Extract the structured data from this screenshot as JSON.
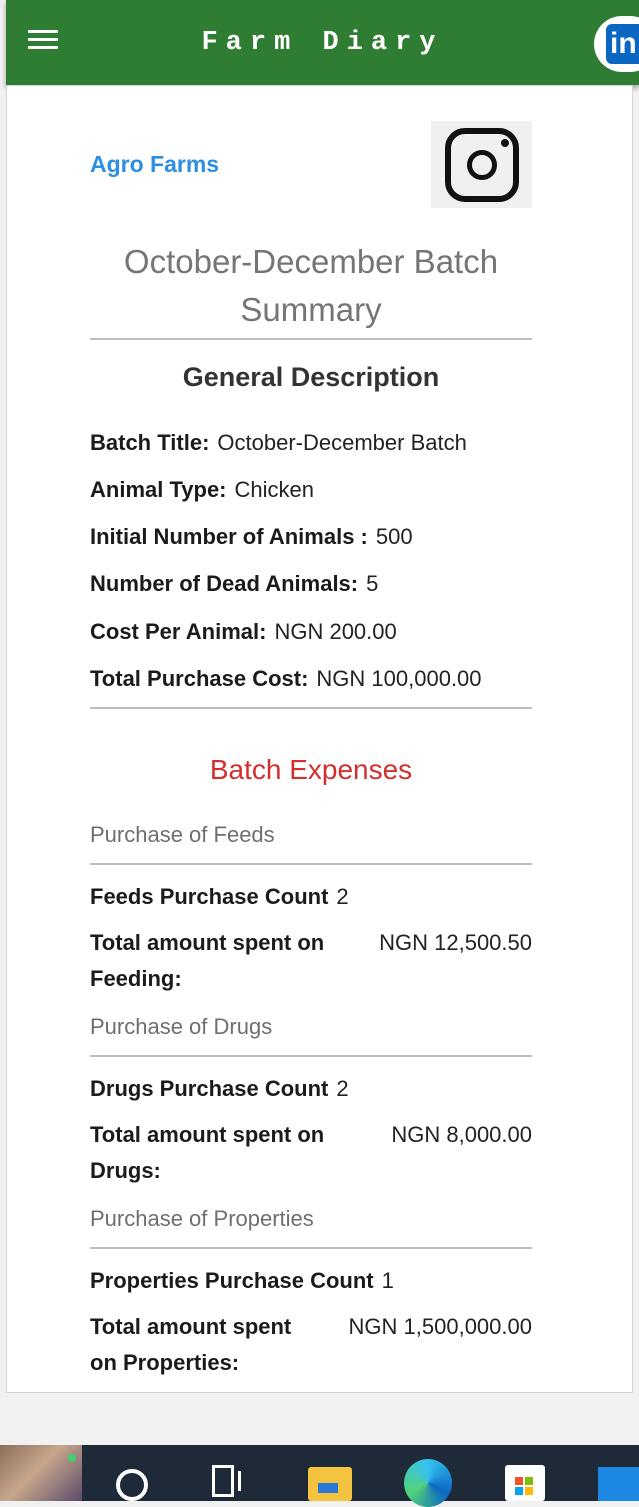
{
  "app_bar": {
    "title": "Farm Diary",
    "menu_icon": "hamburger-menu-icon",
    "profile_icon": "linkedin-icon",
    "profile_label": "in"
  },
  "header": {
    "farm_name": "Agro Farms",
    "social_icon": "instagram-icon"
  },
  "page_title": "October-December Batch Summary",
  "general": {
    "heading": "General Description",
    "fields": [
      {
        "label": "Batch Title:",
        "value": "October-December Batch"
      },
      {
        "label": "Animal Type:",
        "value": "Chicken"
      },
      {
        "label": "Initial Number of Animals :",
        "value": "500"
      },
      {
        "label": "Number of Dead Animals:",
        "value": "5"
      },
      {
        "label": "Cost Per Animal:",
        "value": "NGN 200.00"
      },
      {
        "label": "Total Purchase Cost:",
        "value": "NGN 100,000.00"
      }
    ]
  },
  "expenses": {
    "heading": "Batch Expenses",
    "groups": [
      {
        "title": "Purchase of Feeds",
        "count_label": "Feeds Purchase Count",
        "count": "2",
        "total_label": "Total amount spent on Feeding:",
        "total": "NGN 12,500.50"
      },
      {
        "title": "Purchase of Drugs",
        "count_label": "Drugs Purchase Count",
        "count": "2",
        "total_label": "Total amount spent on Drugs:",
        "total": "NGN 8,000.00"
      },
      {
        "title": "Purchase of Properties",
        "count_label": "Properties Purchase Count",
        "count": "1",
        "total_label": "Total amount spent on Properties:",
        "total": "NGN 1,500,000.00"
      }
    ]
  },
  "colors": {
    "app_bar": "#2e7d32",
    "link": "#2d8fdf",
    "expenses_heading": "#d32f2f"
  },
  "taskbar": {
    "icons": [
      "start-wallpaper-icon",
      "search-icon",
      "task-view-icon",
      "file-explorer-icon",
      "edge-browser-icon",
      "store-icon",
      "mail-icon"
    ]
  }
}
